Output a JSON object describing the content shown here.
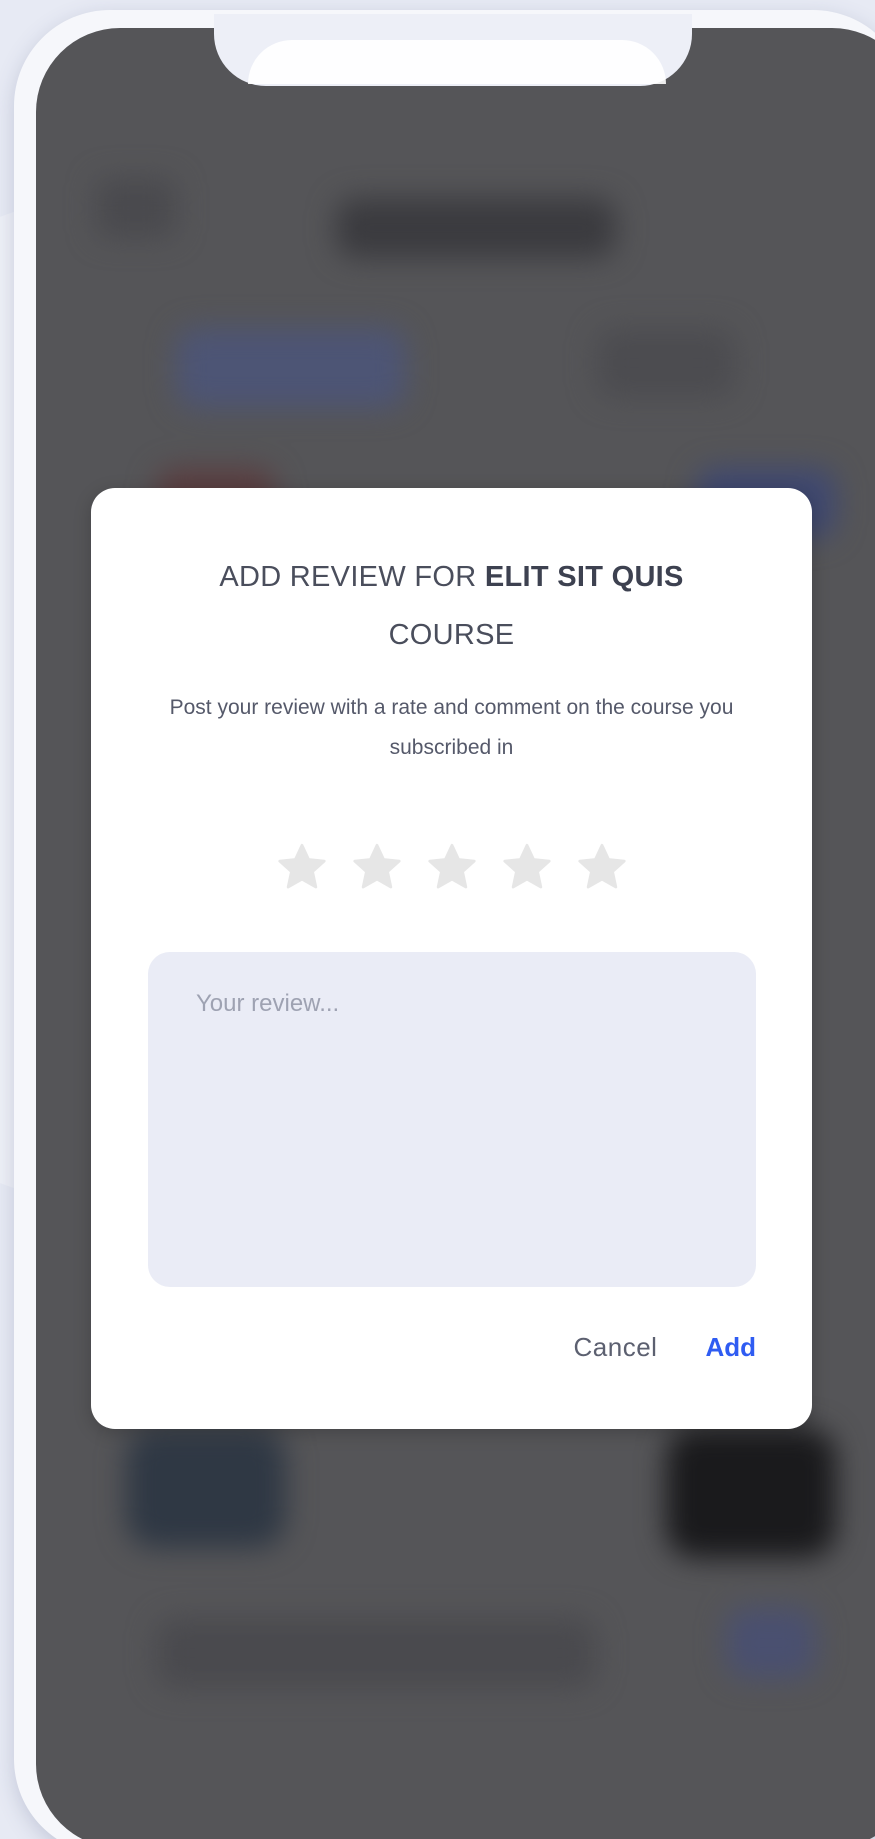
{
  "dialog": {
    "title_prefix": "ADD REVIEW FOR ",
    "course_name": "ELIT SIT QUIS",
    "title_suffix": "COURSE",
    "subtitle": "Post your review with a rate and comment on the course you subscribed in",
    "rating": {
      "max": 5,
      "value": 0,
      "empty_color": "#e6e6e6"
    },
    "review_input": {
      "placeholder": "Your review...",
      "value": ""
    },
    "cancel_label": "Cancel",
    "add_label": "Add",
    "accent_color": "#2f5cf2"
  }
}
